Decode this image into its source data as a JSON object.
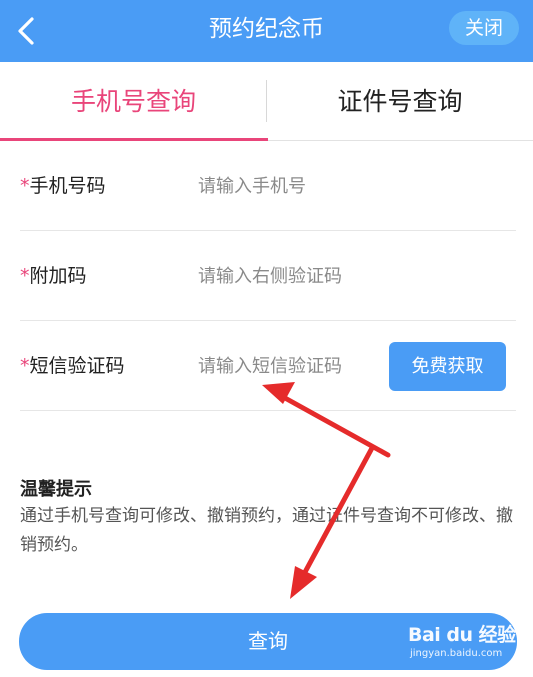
{
  "header": {
    "title": "预约纪念币",
    "close_label": "关闭",
    "color": "#4a9cf5"
  },
  "tabs": [
    {
      "label": "手机号查询",
      "active": true
    },
    {
      "label": "证件号查询",
      "active": false
    }
  ],
  "form": {
    "rows": [
      {
        "required_mark": "*",
        "label": "手机号码",
        "placeholder": "请输入手机号"
      },
      {
        "required_mark": "*",
        "label": "附加码",
        "placeholder": "请输入右侧验证码"
      },
      {
        "required_mark": "*",
        "label": "短信验证码",
        "placeholder": "请输入短信验证码",
        "button_label": "免费获取"
      }
    ]
  },
  "tip": {
    "title": "温馨提示",
    "text": "通过手机号查询可修改、撤销预约，通过证件号查询不可修改、撤销预约。"
  },
  "query_button_label": "查询",
  "watermark": {
    "main": "Bai du 经验",
    "sub": "jingyan.baidu.com"
  },
  "colors": {
    "accent": "#4a9cf5",
    "active_tab": "#e9457a",
    "annotation_arrow": "#e52b2b"
  }
}
